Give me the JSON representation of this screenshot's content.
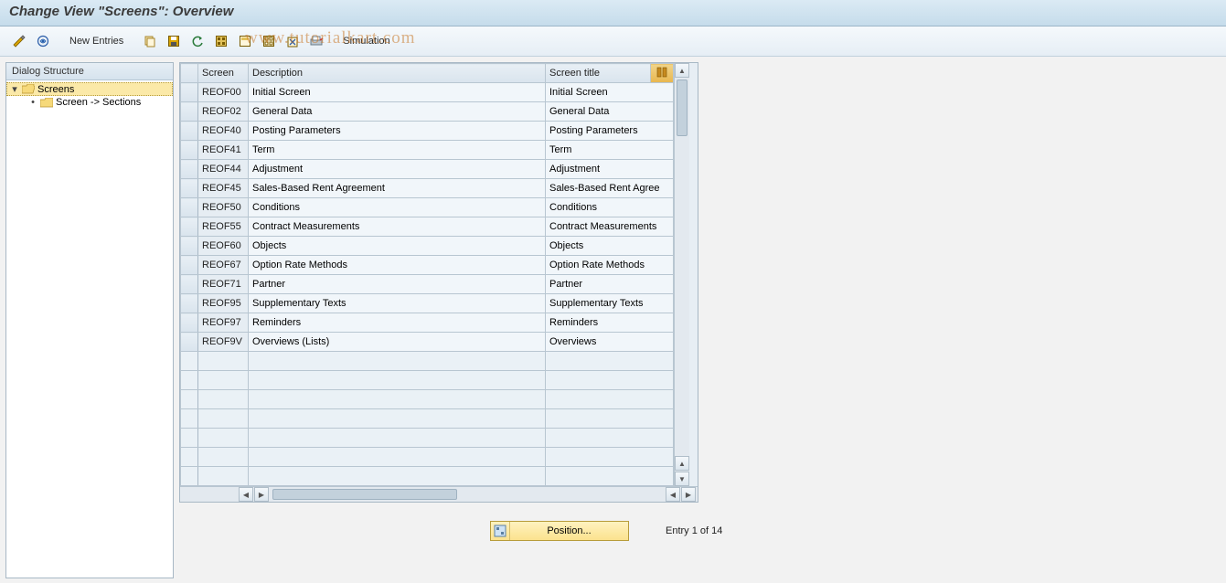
{
  "title": "Change View \"Screens\": Overview",
  "toolbar": {
    "new_entries_label": "New Entries",
    "simulation_label": "Simulation",
    "icons": {
      "toggle": "toggle-display-change",
      "other_view": "other-view",
      "copy": "copy-as",
      "save": "save",
      "undo": "undo-change",
      "select_all": "select-all",
      "select_block": "select-block",
      "deselect_all": "deselect-all",
      "delete": "delete",
      "print": "print"
    }
  },
  "watermark": "www.tutorialkart.com",
  "tree": {
    "header": "Dialog Structure",
    "root_label": "Screens",
    "child_label": "Screen -> Sections"
  },
  "table": {
    "columns": {
      "screen": "Screen",
      "description": "Description",
      "title": "Screen title"
    },
    "rows": [
      {
        "screen": "REOF00",
        "description": "Initial Screen",
        "title": "Initial Screen"
      },
      {
        "screen": "REOF02",
        "description": "General Data",
        "title": "General Data"
      },
      {
        "screen": "REOF40",
        "description": "Posting Parameters",
        "title": "Posting Parameters"
      },
      {
        "screen": "REOF41",
        "description": "Term",
        "title": "Term"
      },
      {
        "screen": "REOF44",
        "description": "Adjustment",
        "title": "Adjustment"
      },
      {
        "screen": "REOF45",
        "description": "Sales-Based Rent Agreement",
        "title": "Sales-Based Rent Agree"
      },
      {
        "screen": "REOF50",
        "description": "Conditions",
        "title": "Conditions"
      },
      {
        "screen": "REOF55",
        "description": "Contract Measurements",
        "title": "Contract Measurements"
      },
      {
        "screen": "REOF60",
        "description": "Objects",
        "title": "Objects"
      },
      {
        "screen": "REOF67",
        "description": "Option Rate Methods",
        "title": "Option Rate Methods"
      },
      {
        "screen": "REOF71",
        "description": "Partner",
        "title": "Partner"
      },
      {
        "screen": "REOF95",
        "description": "Supplementary Texts",
        "title": "Supplementary Texts"
      },
      {
        "screen": "REOF97",
        "description": "Reminders",
        "title": "Reminders"
      },
      {
        "screen": "REOF9V",
        "description": "Overviews (Lists)",
        "title": "Overviews"
      }
    ],
    "empty_rows": 7
  },
  "footer": {
    "position_label": "Position...",
    "entry_text": "Entry 1 of 14"
  }
}
